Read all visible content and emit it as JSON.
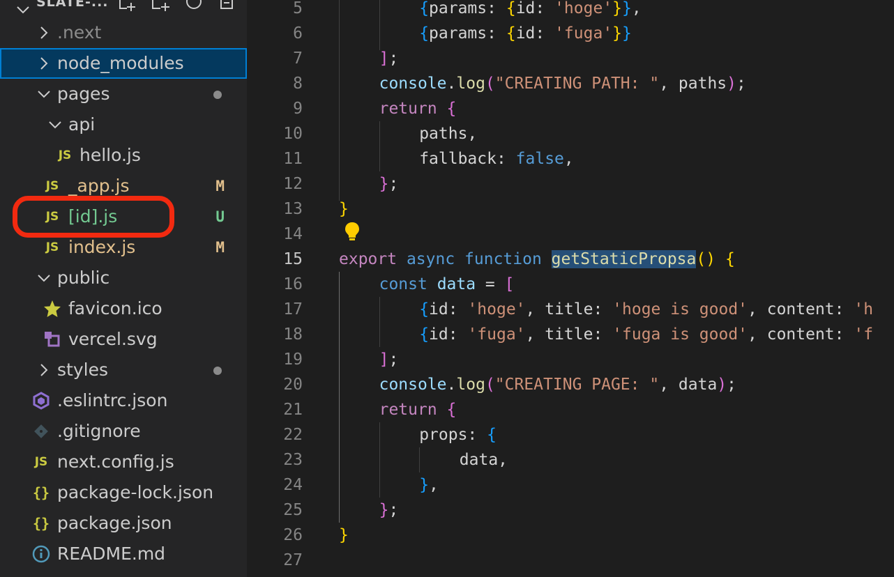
{
  "sidebar": {
    "title": "SLATE-...",
    "tree": [
      {
        "label": "node_modules",
        "type": "folder",
        "collapsed": true,
        "depth": 0,
        "selected": true
      },
      {
        "label": "pages",
        "type": "folder",
        "collapsed": false,
        "depth": 0,
        "dot": true
      },
      {
        "label": "api",
        "type": "folder",
        "collapsed": false,
        "depth": 1
      },
      {
        "label": "hello.js",
        "type": "js",
        "depth": 2
      },
      {
        "label": "_app.js",
        "type": "js",
        "depth": 1,
        "badge": "M"
      },
      {
        "label": "[id].js",
        "type": "js",
        "depth": 1,
        "badge": "U"
      },
      {
        "label": "index.js",
        "type": "js",
        "depth": 1,
        "badge": "M"
      },
      {
        "label": "public",
        "type": "folder",
        "collapsed": false,
        "depth": 0
      },
      {
        "label": "favicon.ico",
        "type": "star",
        "depth": 1
      },
      {
        "label": "vercel.svg",
        "type": "svg",
        "depth": 1
      },
      {
        "label": "styles",
        "type": "folder",
        "collapsed": true,
        "depth": 0,
        "dot": true
      },
      {
        "label": ".eslintrc.json",
        "type": "eslint",
        "depth": 0
      },
      {
        "label": ".gitignore",
        "type": "git",
        "depth": 0
      },
      {
        "label": "next.config.js",
        "type": "js",
        "depth": 0
      },
      {
        "label": "package-lock.json",
        "type": "json",
        "depth": 0
      },
      {
        "label": "package.json",
        "type": "json",
        "depth": 0
      },
      {
        "label": "README.md",
        "type": "info",
        "depth": 0
      }
    ],
    "partial_top_item": ".next"
  },
  "status_colors": {
    "M": "#e2c08d",
    "U": "#73c991"
  },
  "editor": {
    "active_line": 15,
    "lines": [
      {
        "n": "5",
        "tokens": [
          [
            "b3",
            "{"
          ],
          [
            "p",
            "params: "
          ],
          [
            "b1",
            "{"
          ],
          [
            "p",
            "id: "
          ],
          [
            "str",
            "'hoge'"
          ],
          [
            "b1",
            "}"
          ],
          [
            "b3",
            "}"
          ],
          [
            "p",
            ","
          ]
        ]
      },
      {
        "n": "6",
        "tokens": [
          [
            "b3",
            "{"
          ],
          [
            "p",
            "params: "
          ],
          [
            "b1",
            "{"
          ],
          [
            "p",
            "id: "
          ],
          [
            "str",
            "'fuga'"
          ],
          [
            "b1",
            "}"
          ],
          [
            "b3",
            "}"
          ]
        ]
      },
      {
        "n": "7",
        "tokens": [
          [
            "b2",
            "]"
          ],
          [
            "p",
            ";"
          ]
        ]
      },
      {
        "n": "8",
        "tokens": [
          [
            "var",
            "console"
          ],
          [
            "p",
            "."
          ],
          [
            "fn",
            "log"
          ],
          [
            "b2",
            "("
          ],
          [
            "str",
            "\"CREATING PATH: \""
          ],
          [
            "p",
            ", paths"
          ],
          [
            "b2",
            ")"
          ],
          [
            "p",
            ";"
          ]
        ]
      },
      {
        "n": "9",
        "tokens": [
          [
            "flow",
            "return "
          ],
          [
            "b2",
            "{"
          ]
        ]
      },
      {
        "n": "10",
        "tokens": [
          [
            "p",
            "paths,"
          ]
        ]
      },
      {
        "n": "11",
        "tokens": [
          [
            "p",
            "fallback: "
          ],
          [
            "kw",
            "false"
          ],
          [
            "p",
            ","
          ]
        ]
      },
      {
        "n": "12",
        "tokens": [
          [
            "b2",
            "}"
          ],
          [
            "p",
            ";"
          ]
        ]
      },
      {
        "n": "13",
        "tokens": [
          [
            "b1",
            "}"
          ]
        ]
      },
      {
        "n": "14",
        "tokens": []
      },
      {
        "n": "15",
        "tokens": [
          [
            "flow",
            "export "
          ],
          [
            "kw",
            "async "
          ],
          [
            "kw",
            "function "
          ],
          [
            "fnhl",
            "getStaticPropsa"
          ],
          [
            "b1",
            "()"
          ],
          [
            "p",
            " "
          ],
          [
            "b1",
            "{"
          ]
        ]
      },
      {
        "n": "16",
        "tokens": [
          [
            "kw",
            "const "
          ],
          [
            "var",
            "data"
          ],
          [
            "p",
            " = "
          ],
          [
            "b2",
            "["
          ]
        ]
      },
      {
        "n": "17",
        "tokens": [
          [
            "b3",
            "{"
          ],
          [
            "p",
            "id: "
          ],
          [
            "str",
            "'hoge'"
          ],
          [
            "p",
            ", title: "
          ],
          [
            "str",
            "'hoge is good'"
          ],
          [
            "p",
            ", content: "
          ],
          [
            "str",
            "'h"
          ]
        ]
      },
      {
        "n": "18",
        "tokens": [
          [
            "b3",
            "{"
          ],
          [
            "p",
            "id: "
          ],
          [
            "str",
            "'fuga'"
          ],
          [
            "p",
            ", title: "
          ],
          [
            "str",
            "'fuga is good'"
          ],
          [
            "p",
            ", content: "
          ],
          [
            "str",
            "'f"
          ]
        ]
      },
      {
        "n": "19",
        "tokens": [
          [
            "b2",
            "]"
          ],
          [
            "p",
            ";"
          ]
        ]
      },
      {
        "n": "20",
        "tokens": [
          [
            "var",
            "console"
          ],
          [
            "p",
            "."
          ],
          [
            "fn",
            "log"
          ],
          [
            "b2",
            "("
          ],
          [
            "str",
            "\"CREATING PAGE: \""
          ],
          [
            "p",
            ", data"
          ],
          [
            "b2",
            ")"
          ],
          [
            "p",
            ";"
          ]
        ]
      },
      {
        "n": "21",
        "tokens": [
          [
            "flow",
            "return "
          ],
          [
            "b2",
            "{"
          ]
        ]
      },
      {
        "n": "22",
        "tokens": [
          [
            "p",
            "props: "
          ],
          [
            "b3",
            "{"
          ]
        ]
      },
      {
        "n": "23",
        "tokens": [
          [
            "p",
            "data,"
          ]
        ]
      },
      {
        "n": "24",
        "tokens": [
          [
            "b3",
            "}"
          ],
          [
            "p",
            ","
          ]
        ]
      },
      {
        "n": "25",
        "tokens": [
          [
            "b2",
            "}"
          ],
          [
            "p",
            ";"
          ]
        ]
      },
      {
        "n": "26",
        "tokens": [
          [
            "b1",
            "}"
          ]
        ]
      },
      {
        "n": "27",
        "tokens": []
      }
    ]
  }
}
